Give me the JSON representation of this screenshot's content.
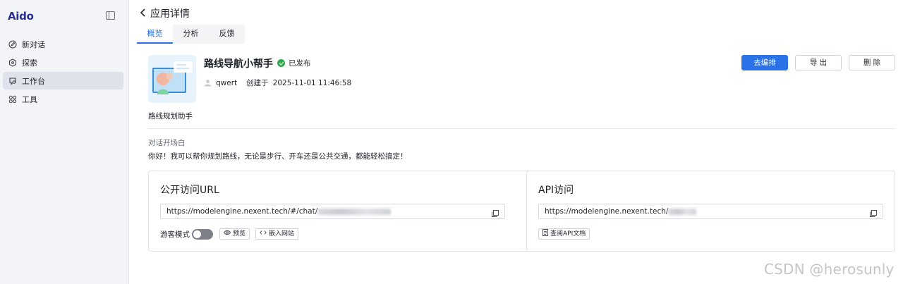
{
  "brand": {
    "logo": "Aido"
  },
  "sidebar": {
    "items": [
      {
        "label": "新对话",
        "icon": "edit-icon"
      },
      {
        "label": "探索",
        "icon": "compass-icon"
      },
      {
        "label": "工作台",
        "icon": "workspace-icon",
        "active": true
      },
      {
        "label": "工具",
        "icon": "apps-grid-icon"
      }
    ]
  },
  "header": {
    "title": "应用详情"
  },
  "tabs": [
    {
      "label": "概览",
      "active": true
    },
    {
      "label": "分析"
    },
    {
      "label": "反馈"
    }
  ],
  "app": {
    "name": "路线导航小帮手",
    "status": "已发布",
    "author": "qwert",
    "created_label": "创建于",
    "created_at": "2025-11-01 11:46:58",
    "description": "路线规划助手"
  },
  "actions": {
    "edit": "去编排",
    "export": "导 出",
    "delete": "删 除"
  },
  "opening": {
    "title": "对话开场白",
    "text": "你好！我可以帮你规划路线，无论是步行、开车还是公共交通，都能轻松搞定！"
  },
  "public_url": {
    "title": "公开访问URL",
    "url": "https://modelengine.nexent.tech/#/chat/",
    "guest_mode_label": "游客模式",
    "guest_mode_on": false,
    "preview_label": "预览",
    "embed_label": "嵌入网站"
  },
  "api": {
    "title": "API访问",
    "url": "https://modelengine.nexent.tech/",
    "docs_label": "查阅API文档"
  },
  "watermark": "CSDN @herosunly",
  "colors": {
    "primary": "#2b72e8",
    "published": "#2fa84f",
    "sidebar_bg": "#f3f4f7"
  }
}
